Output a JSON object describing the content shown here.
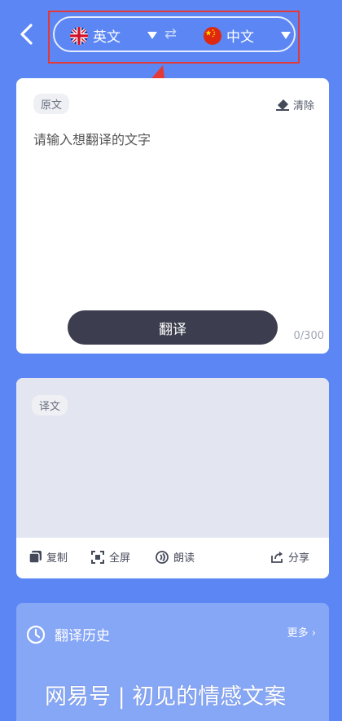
{
  "header": {
    "source_language": "英文",
    "target_language": "中文",
    "swap_symbol": "⇄"
  },
  "input_card": {
    "tag": "原文",
    "clear_label": "清除",
    "placeholder": "请输入想翻译的文字",
    "translate_button": "翻译",
    "char_count": "0/300"
  },
  "output_card": {
    "tag": "译文",
    "actions": {
      "copy": "复制",
      "fullscreen": "全屏",
      "read_aloud": "朗读",
      "share": "分享"
    }
  },
  "history": {
    "title": "翻译历史",
    "more": "更多 ›"
  },
  "watermark": "网易号 | 初见的情感文案",
  "colors": {
    "background": "#5b86f4",
    "button_dark": "#3c3d4e",
    "annotation_red": "#e53935",
    "output_bg": "#e3e6f1"
  }
}
